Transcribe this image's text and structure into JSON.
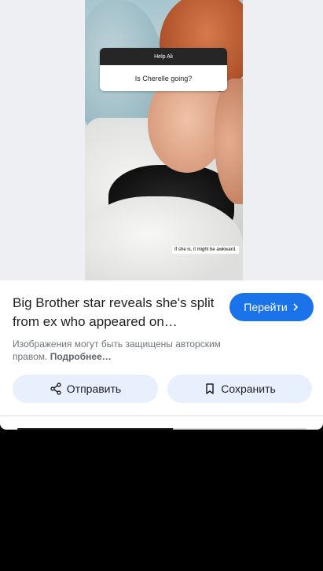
{
  "image": {
    "question_header": "Help Ali",
    "question_text": "Is Cherelle going?",
    "caption": "If she is, it might be awkward."
  },
  "result": {
    "title": "Big Brother star reveals she's split from ex who appeared on…",
    "visit_label": "Перейти",
    "copyright_text": "Изображения могут быть защищены авторским правом.",
    "copyright_link": "Подробнее…",
    "share_label": "Отправить",
    "save_label": "Сохранить"
  },
  "colors": {
    "accent": "#1a73e8",
    "chip_bg": "#e8f0fe"
  },
  "icons": [
    "chevron-right-icon",
    "share-icon",
    "bookmark-icon"
  ]
}
